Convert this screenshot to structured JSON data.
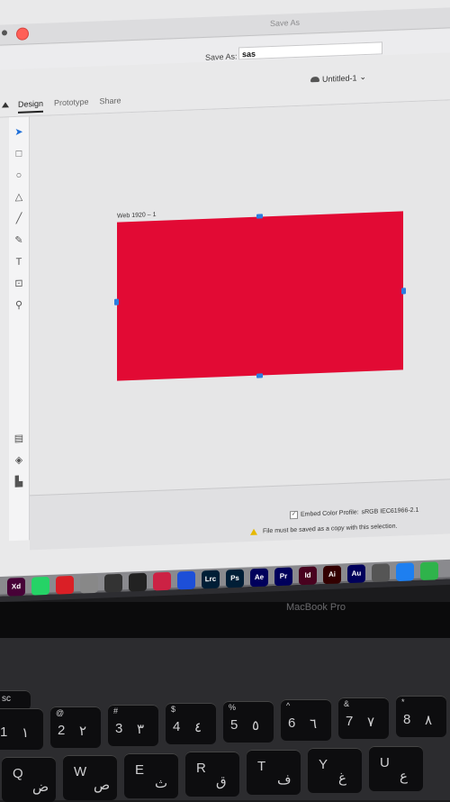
{
  "dialog": {
    "title": "Save As",
    "save_as_label": "Save As:",
    "save_as_value": "sas"
  },
  "app": {
    "document_title": "Untitled-1",
    "tabs": [
      "Design",
      "Prototype",
      "Share"
    ],
    "artboard_label": "Web 1920 – 1",
    "artboard_color": "#e20a34"
  },
  "export_panel": {
    "embed_label": "Embed Color Profile:",
    "embed_value": "sRGB IEC61966-2.1",
    "embed_checked": true,
    "warning": "File must be saved as a copy with this selection."
  },
  "dock": {
    "apps": [
      {
        "label": "Xd",
        "color": "#470137"
      },
      {
        "label": "",
        "color": "#25d366"
      },
      {
        "label": "",
        "color": "#da1f26"
      },
      {
        "label": "",
        "color": "#888888"
      },
      {
        "label": "",
        "color": "#333333"
      },
      {
        "label": "",
        "color": "#222222"
      },
      {
        "label": "",
        "color": "#cc2244"
      },
      {
        "label": "",
        "color": "#1d4fd8"
      },
      {
        "label": "Lrc",
        "color": "#001e36"
      },
      {
        "label": "Ps",
        "color": "#001e36"
      },
      {
        "label": "Ae",
        "color": "#00005b"
      },
      {
        "label": "Pr",
        "color": "#00005b"
      },
      {
        "label": "Id",
        "color": "#49021f"
      },
      {
        "label": "Ai",
        "color": "#330000"
      },
      {
        "label": "Au",
        "color": "#00005b"
      },
      {
        "label": "",
        "color": "#555555"
      },
      {
        "label": "",
        "color": "#1e7ff0"
      },
      {
        "label": "",
        "color": "#2fb34b"
      }
    ]
  },
  "laptop": {
    "model": "MacBook Pro"
  },
  "keyboard": {
    "esc": "sc",
    "row_numbers": [
      {
        "top": "!",
        "main": "1",
        "alt": "١"
      },
      {
        "top": "@",
        "main": "2",
        "alt": "٢"
      },
      {
        "top": "#",
        "main": "3",
        "alt": "٣"
      },
      {
        "top": "$",
        "main": "4",
        "alt": "٤"
      },
      {
        "top": "%",
        "main": "5",
        "alt": "٥"
      },
      {
        "top": "^",
        "main": "6",
        "alt": "٦"
      },
      {
        "top": "&",
        "main": "7",
        "alt": "٧"
      },
      {
        "top": "*",
        "main": "8",
        "alt": "٨"
      }
    ],
    "row_letters": [
      {
        "main": "Q",
        "alt": "ض"
      },
      {
        "main": "W",
        "alt": "ص"
      },
      {
        "main": "E",
        "alt": "ث"
      },
      {
        "main": "R",
        "alt": "ق"
      },
      {
        "main": "T",
        "alt": "ف"
      },
      {
        "main": "Y",
        "alt": "غ"
      },
      {
        "main": "U",
        "alt": "ع"
      }
    ]
  }
}
